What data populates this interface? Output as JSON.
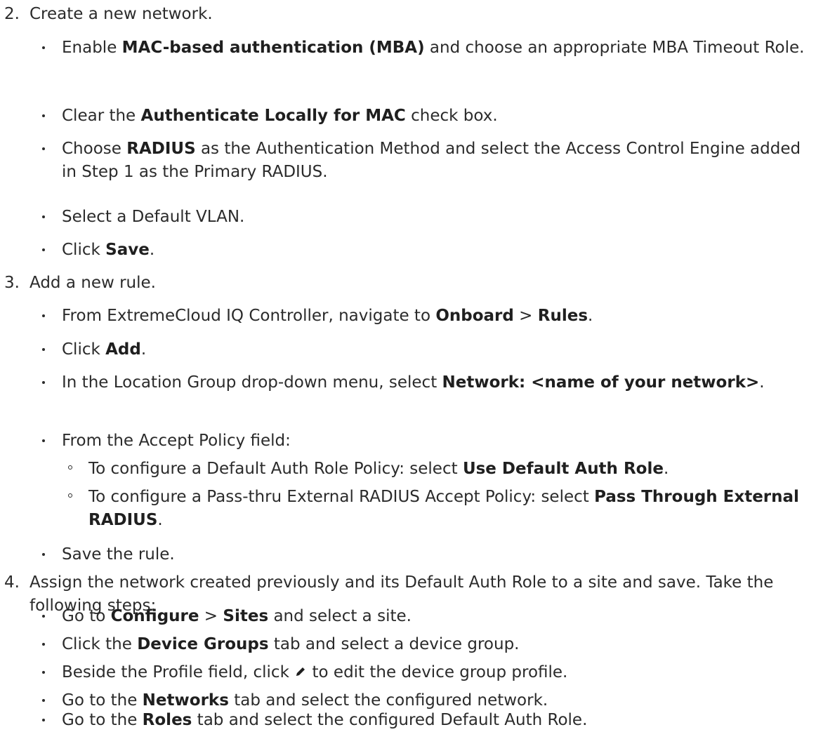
{
  "steps": [
    {
      "number": "2.",
      "text": "Create a new network.",
      "bullets": [
        {
          "parts": [
            {
              "t": "Enable "
            },
            {
              "b": "MAC-based authentication (MBA)"
            },
            {
              "t": " and choose an appropriate MBA Timeout Role."
            }
          ]
        },
        {
          "parts": [
            {
              "t": "Clear the "
            },
            {
              "b": "Authenticate Locally for MAC"
            },
            {
              "t": " check box."
            }
          ]
        },
        {
          "parts": [
            {
              "t": "Choose "
            },
            {
              "b": "RADIUS"
            },
            {
              "t": " as the Authentication Method and select the Access Control Engine added in Step 1 as the Primary RADIUS."
            }
          ]
        },
        {
          "parts": [
            {
              "t": "Select a Default VLAN."
            }
          ]
        },
        {
          "parts": [
            {
              "t": "Click "
            },
            {
              "b": "Save"
            },
            {
              "t": "."
            }
          ]
        }
      ]
    },
    {
      "number": "3.",
      "text": "Add a new rule.",
      "bullets": [
        {
          "parts": [
            {
              "t": "From ExtremeCloud IQ Controller, navigate to "
            },
            {
              "b": "Onboard"
            },
            {
              "t": " > "
            },
            {
              "b": "Rules"
            },
            {
              "t": "."
            }
          ]
        },
        {
          "parts": [
            {
              "t": "Click "
            },
            {
              "b": "Add"
            },
            {
              "t": "."
            }
          ]
        },
        {
          "parts": [
            {
              "t": "In the Location Group drop-down menu, select "
            },
            {
              "b": "Network: <name of your network>"
            },
            {
              "t": "."
            }
          ]
        },
        {
          "parts": [
            {
              "t": "From the Accept Policy field:"
            }
          ],
          "sub": [
            {
              "parts": [
                {
                  "t": "To configure a Default Auth Role Policy: select "
                },
                {
                  "b": "Use Default Auth Role"
                },
                {
                  "t": "."
                }
              ]
            },
            {
              "parts": [
                {
                  "t": "To configure a Pass-thru External RADIUS Accept Policy: select "
                },
                {
                  "b": "Pass Through External RADIUS"
                },
                {
                  "t": "."
                }
              ]
            }
          ]
        },
        {
          "parts": [
            {
              "t": "Save the rule."
            }
          ]
        }
      ]
    },
    {
      "number": "4.",
      "text": "Assign the network created previously and its Default Auth Role to a site and save. Take the following steps:",
      "bullets": [
        {
          "parts": [
            {
              "t": "Go to "
            },
            {
              "b": "Configure"
            },
            {
              "t": " > "
            },
            {
              "b": "Sites"
            },
            {
              "t": " and select a site."
            }
          ]
        },
        {
          "parts": [
            {
              "t": "Click the "
            },
            {
              "b": "Device Groups"
            },
            {
              "t": " tab and select a device group."
            }
          ]
        },
        {
          "parts": [
            {
              "t": "Beside the Profile field, click "
            },
            {
              "icon": "pencil-icon"
            },
            {
              "t": " to edit the device group profile."
            }
          ]
        },
        {
          "parts": [
            {
              "t": "Go to the "
            },
            {
              "b": "Networks"
            },
            {
              "t": " tab and select the configured network."
            }
          ]
        },
        {
          "parts": [
            {
              "t": "Go to the "
            },
            {
              "b": "Roles"
            },
            {
              "t": " tab and select the configured Default Auth Role."
            }
          ]
        }
      ]
    }
  ]
}
